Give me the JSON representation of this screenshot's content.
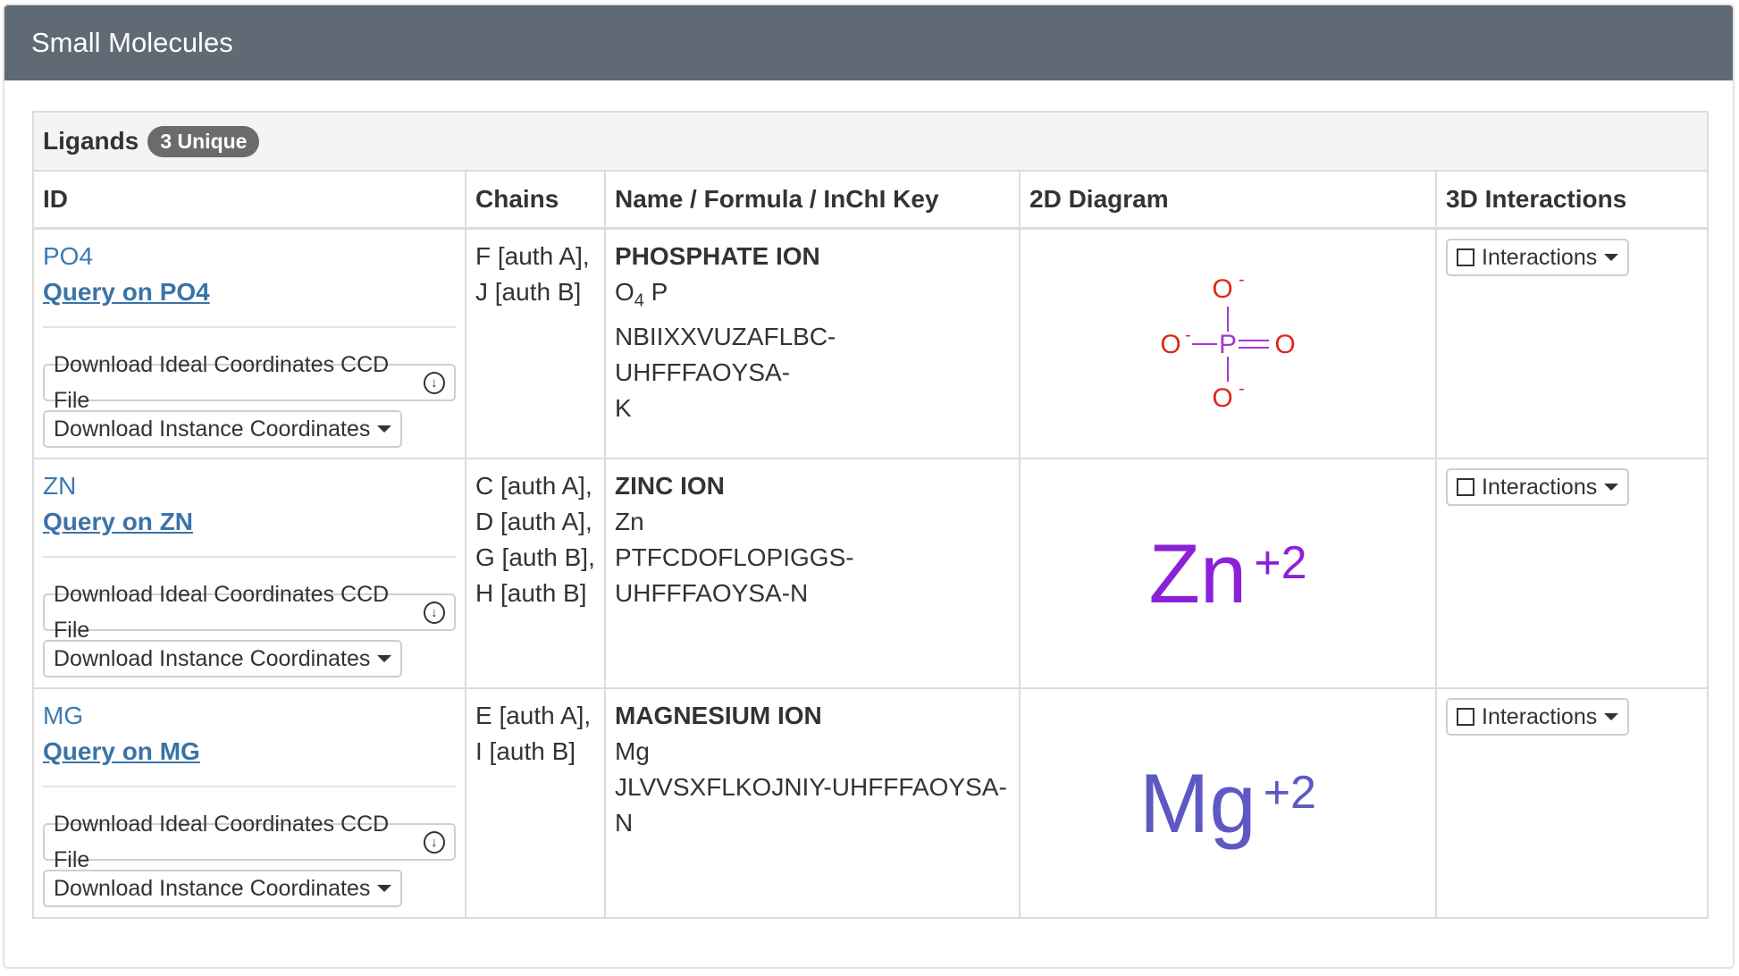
{
  "panel": {
    "title": "Small Molecules"
  },
  "ligands": {
    "title": "Ligands",
    "badge": "3 Unique",
    "headers": [
      "ID",
      "Chains",
      "Name / Formula / InChI Key",
      "2D Diagram",
      "3D Interactions"
    ],
    "download_ccd_label": "Download Ideal Coordinates CCD File",
    "download_instance_label": "Download Instance Coordinates",
    "interactions_label": "Interactions",
    "rows": [
      {
        "id": "PO4",
        "query": "Query on PO4",
        "chains": [
          "F [auth A],",
          "J [auth B]"
        ],
        "name": "PHOSPHATE ION",
        "formula_main": "O",
        "formula_sub": "4",
        "formula_rest": " P",
        "inchi": [
          "NBIIXXVUZAFLBC-UHFFFAOYSA-",
          "K"
        ],
        "diagram": {
          "atom_center": "P",
          "atom_o": "O",
          "charge": "-"
        }
      },
      {
        "id": "ZN",
        "query": "Query on ZN",
        "chains": [
          "C [auth A],",
          "D [auth A],",
          "G [auth B],",
          "H [auth B]"
        ],
        "name": "ZINC ION",
        "formula_main": "Zn",
        "inchi": [
          "PTFCDOFLOPIGGS-",
          "UHFFFAOYSA-N"
        ],
        "diagram": {
          "symbol": "Zn",
          "charge": "+2",
          "color": "#8b22d8"
        }
      },
      {
        "id": "MG",
        "query": "Query on MG",
        "chains": [
          "E [auth A],",
          "I [auth B]"
        ],
        "name": "MAGNESIUM ION",
        "formula_main": "Mg",
        "inchi": [
          "JLVVSXFLKOJNIY-UHFFFAOYSA-",
          "N"
        ],
        "diagram": {
          "symbol": "Mg",
          "charge": "+2",
          "color": "#5e58c4"
        }
      }
    ]
  },
  "colors": {
    "header_bg": "#5f6a75",
    "link": "#3c78b5",
    "oxygen": "#e0281d",
    "phosphorus": "#a637d6"
  },
  "icons": [
    "download-circle-icon",
    "caret-down-icon",
    "cube-icon"
  ]
}
